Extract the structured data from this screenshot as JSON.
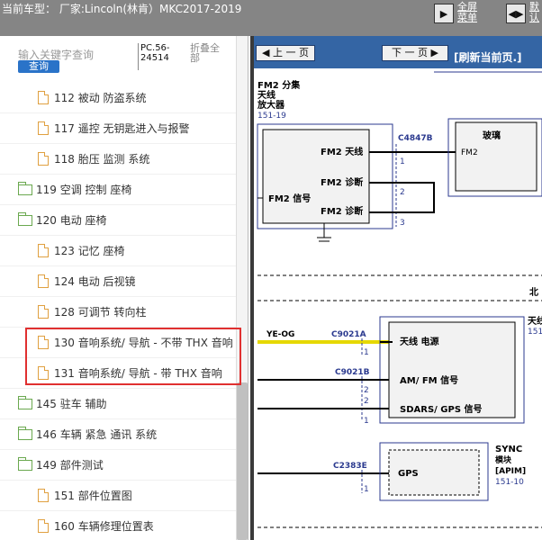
{
  "topbar": {
    "vehicle_text": "当前车型：  厂家:Lincoln(林肯）MKC2017-2019",
    "menu_button": {
      "icon": "▶",
      "label": "全屏\n菜单"
    },
    "default_button": {
      "icon": "◀▶",
      "label": "默\n认"
    }
  },
  "left_panel": {
    "search_placeholder": "输入关键字查询",
    "search_button": "查询",
    "code_label": "PC.56-24514",
    "fold_label": "折叠全部",
    "tree": [
      {
        "label": "112 被动 防盗系统",
        "kind": "doc"
      },
      {
        "label": "117 遥控 无钥匙进入与报警",
        "kind": "doc"
      },
      {
        "label": "118 胎压 监测 系统",
        "kind": "doc"
      },
      {
        "label": "119 空调 控制 座椅",
        "kind": "folder"
      },
      {
        "label": "120 电动 座椅",
        "kind": "folder"
      },
      {
        "label": "123 记忆 座椅",
        "kind": "doc"
      },
      {
        "label": "124 电动 后视镜",
        "kind": "doc"
      },
      {
        "label": "128 可调节 转向柱",
        "kind": "doc"
      },
      {
        "label": "130 音响系统/ 导航 - 不带 THX 音响",
        "kind": "doc"
      },
      {
        "label": "131 音响系统/ 导航 - 带 THX 音响",
        "kind": "doc"
      },
      {
        "label": "145 驻车 辅助",
        "kind": "folder"
      },
      {
        "label": "146 车辆 紧急 通讯 系统",
        "kind": "folder"
      },
      {
        "label": "149 部件测试",
        "kind": "folder"
      },
      {
        "label": "151 部件位置图",
        "kind": "doc"
      },
      {
        "label": "160 车辆修理位置表",
        "kind": "doc"
      }
    ]
  },
  "right_panel": {
    "prev_label": "上 一 页",
    "next_label": "下 一 页",
    "refresh_label": "[刷新当前页.]",
    "diagram": {
      "fm2_title": "FM2 分集",
      "fm2_title2": "天线",
      "fm2_title3": "放大器",
      "fm2_ref": "151-19",
      "fm2_antenna": "FM2 天线",
      "fm2_diag1": "FM2 诊断",
      "fm2_diag2": "FM2 诊断",
      "fm2_signal": "FM2 信号",
      "connector_c4847b": "C4847B",
      "glass_label": "玻璃",
      "glass_fm2": "FM2",
      "pin1": "1",
      "pin2": "2",
      "pin3": "3",
      "north_label": "北",
      "antenna_right_title": "天线",
      "antenna_right_ref": "151-",
      "wire_color": "YE-OG",
      "connector_c9021a": "C9021A",
      "connector_c9021b": "C9021B",
      "antenna_power": "天线 电源",
      "am_fm_signal": "AM/ FM 信号",
      "sdars_gps": "SDARS/ GPS 信号",
      "connector_c2383e": "C2383E",
      "gps_label": "GPS",
      "sync_title": "SYNC",
      "sync_module": "模块",
      "sync_apim": "[APIM]",
      "sync_ref": "151-10",
      "pin_a1": "1",
      "pin_b2a": "2",
      "pin_b2b": "2",
      "pin_b1": "1",
      "pin_e1": "1"
    }
  }
}
